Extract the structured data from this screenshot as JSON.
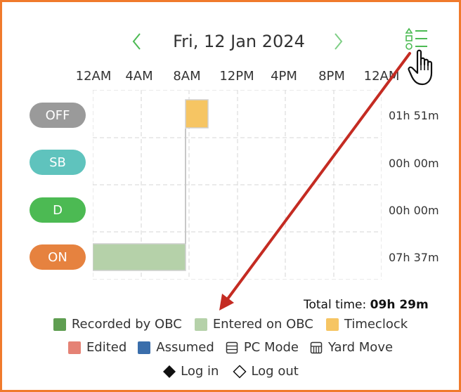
{
  "header": {
    "date": "Fri, 12 Jan 2024"
  },
  "ticks": [
    "12AM",
    "4AM",
    "8AM",
    "12PM",
    "4PM",
    "8PM",
    "12AM"
  ],
  "statuses": [
    {
      "label": "OFF",
      "color": "#9a9a9a",
      "duration": "01h 51m"
    },
    {
      "label": "SB",
      "color": "#5fc3bd",
      "duration": "00h 00m"
    },
    {
      "label": "D",
      "color": "#4cba53",
      "duration": "00h 00m"
    },
    {
      "label": "ON",
      "color": "#e6823f",
      "duration": "07h 37m"
    }
  ],
  "total": {
    "label": "Total time:",
    "value": "09h 29m"
  },
  "legend": {
    "row1": [
      {
        "label": "Recorded by OBC",
        "color": "#5f9e51"
      },
      {
        "label": "Entered on OBC",
        "color": "#b5d1a9"
      },
      {
        "label": "Timeclock",
        "color": "#f6c563"
      }
    ],
    "row2": [
      {
        "label": "Edited",
        "color": "#e58275"
      },
      {
        "label": "Assumed",
        "color": "#3a6eab"
      },
      {
        "label": "PC Mode",
        "icon": "pc-mode-icon"
      },
      {
        "label": "Yard Move",
        "icon": "yard-move-icon"
      }
    ],
    "row3": [
      {
        "label": "Log in",
        "icon": "filled-diamond-icon"
      },
      {
        "label": "Log out",
        "icon": "hollow-diamond-icon"
      }
    ]
  },
  "colors": {
    "accent": "#4cba53",
    "frame": "#f07a2c",
    "arrow": "#c42b22"
  }
}
